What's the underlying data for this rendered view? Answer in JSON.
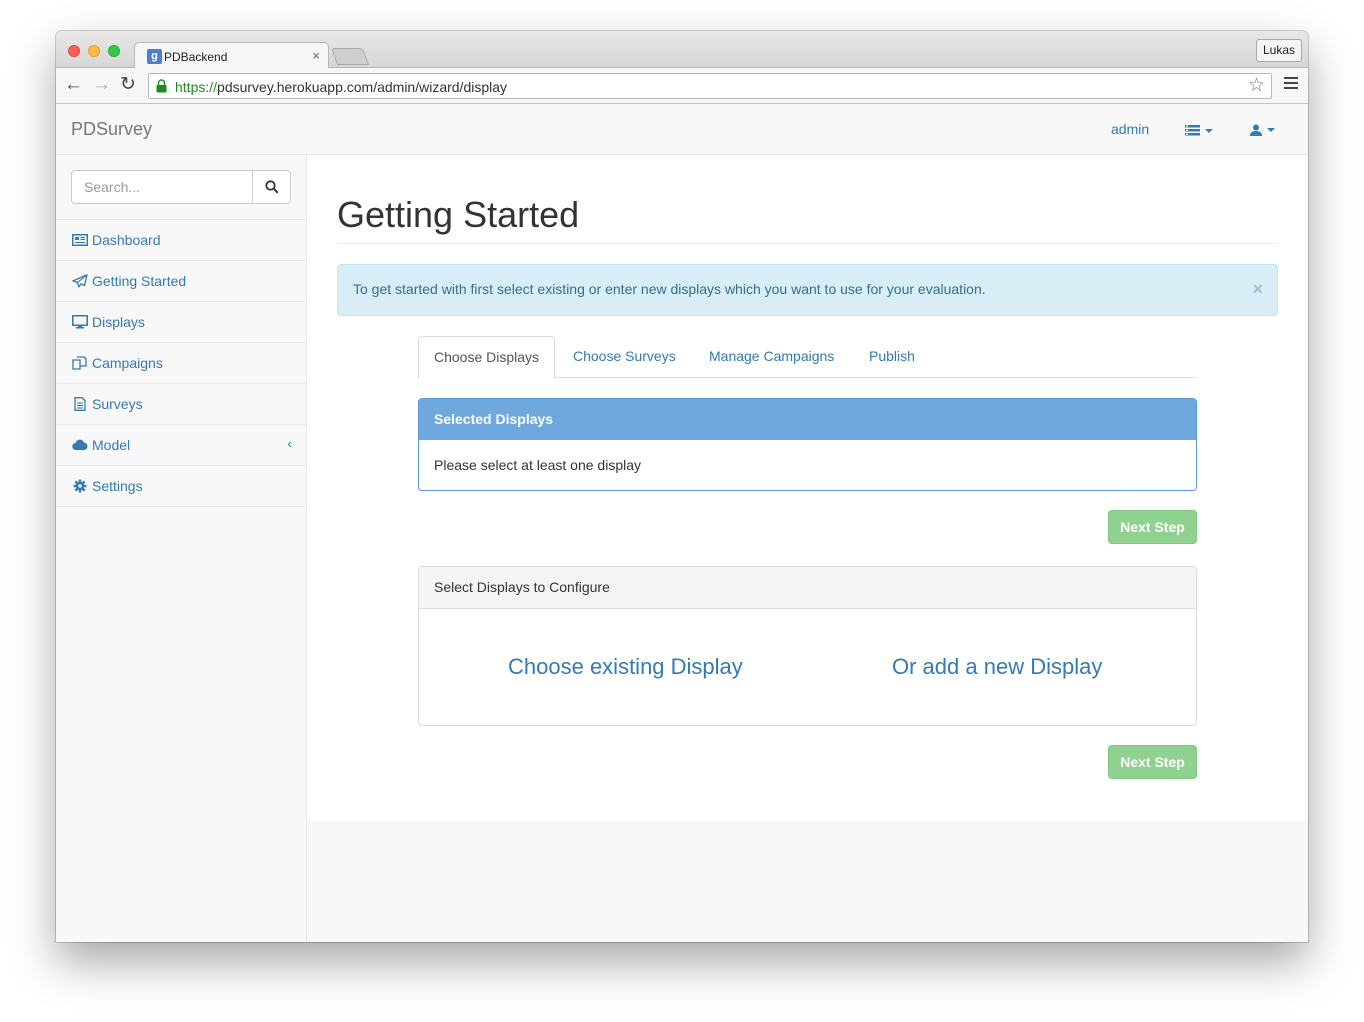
{
  "browser": {
    "tab_title": "PDBackend",
    "tab_close": "×",
    "profile": "Lukas",
    "url_scheme": "https://",
    "url_rest": "pdsurvey.herokuapp.com/admin/wizard/display"
  },
  "navbar": {
    "brand": "PDSurvey",
    "admin": "admin"
  },
  "sidebar": {
    "search_placeholder": "Search...",
    "items": [
      {
        "label": "Dashboard",
        "icon": "dashboard-icon"
      },
      {
        "label": "Getting Started",
        "icon": "paper-plane-icon"
      },
      {
        "label": "Displays",
        "icon": "monitor-icon"
      },
      {
        "label": "Campaigns",
        "icon": "copy-icon"
      },
      {
        "label": "Surveys",
        "icon": "document-icon"
      },
      {
        "label": "Model",
        "icon": "cloud-icon",
        "arrow": "‹"
      },
      {
        "label": "Settings",
        "icon": "gear-icon"
      }
    ]
  },
  "main": {
    "title": "Getting Started",
    "alert": "To get started with first select existing or enter new displays which you want to use for your evaluation.",
    "alert_close": "×",
    "tabs": [
      {
        "label": "Choose Displays",
        "active": true
      },
      {
        "label": "Choose Surveys",
        "active": false
      },
      {
        "label": "Manage Campaigns",
        "active": false
      },
      {
        "label": "Publish",
        "active": false
      }
    ],
    "selected_panel": {
      "heading": "Selected Displays",
      "body": "Please select at least one display"
    },
    "next_button": "Next Step",
    "config_panel": {
      "heading": "Select Displays to Configure",
      "choose_existing": "Choose existing Display",
      "add_new": "Or add a new Display"
    }
  },
  "colors": {
    "link": "#337ab7",
    "panel_primary": "#6ea8dd",
    "alert_bg": "#d9edf7",
    "button_success_disabled": "#8fd28f"
  }
}
